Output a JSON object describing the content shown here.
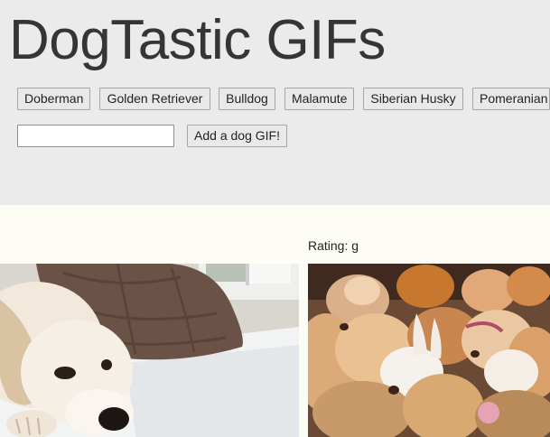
{
  "header": {
    "title": "DogTastic GIFs"
  },
  "breeds": [
    {
      "label": "Doberman"
    },
    {
      "label": "Golden Retriever"
    },
    {
      "label": "Bulldog"
    },
    {
      "label": "Malamute"
    },
    {
      "label": "Siberian Husky"
    },
    {
      "label": "Pomeranian"
    }
  ],
  "form": {
    "input_value": "",
    "input_placeholder": "",
    "submit_label": "Add a dog GIF!"
  },
  "results": {
    "rating_text": "Rating: g",
    "gifs": [
      {
        "description": "golden retriever puppy resting beside pillow"
      },
      {
        "description": "pile of puppies and plush toys"
      }
    ]
  },
  "colors": {
    "header_bg": "#ebebeb",
    "page_bg": "#fdfdf5",
    "title_text": "#353535",
    "button_bg": "#e9e9e9",
    "button_border": "#a6a6a6"
  }
}
